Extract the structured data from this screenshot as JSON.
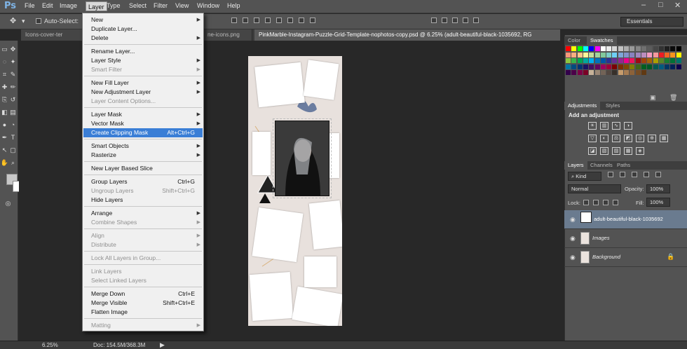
{
  "app": {
    "logo": "Ps"
  },
  "menubar": {
    "items": [
      "File",
      "Edit",
      "Image",
      "Layer",
      "Type",
      "Select",
      "Filter",
      "View",
      "Window",
      "Help"
    ],
    "active": "Layer",
    "window_controls": [
      "–",
      "□",
      "✕"
    ]
  },
  "options": {
    "auto_select_label": "Auto-Select:",
    "workspace": "Essentials"
  },
  "tabs": [
    {
      "label": "Icons-cover-ter"
    },
    {
      "label": "ne-icons.png"
    },
    {
      "label": "PinkMarble-Instagram-Puzzle-Grid-Template-nophotos-copy.psd @ 6.25% (adult-beautiful-black-1035692, RG"
    }
  ],
  "layer_menu": {
    "items": [
      {
        "label": "New",
        "arrow": true
      },
      {
        "label": "Duplicate Layer..."
      },
      {
        "label": "Delete",
        "arrow": true
      },
      {
        "sep": true
      },
      {
        "label": "Rename Layer..."
      },
      {
        "label": "Layer Style",
        "arrow": true
      },
      {
        "label": "Smart Filter",
        "arrow": true,
        "disabled": true
      },
      {
        "sep": true
      },
      {
        "label": "New Fill Layer",
        "arrow": true
      },
      {
        "label": "New Adjustment Layer",
        "arrow": true
      },
      {
        "label": "Layer Content Options...",
        "disabled": true
      },
      {
        "sep": true
      },
      {
        "label": "Layer Mask",
        "arrow": true
      },
      {
        "label": "Vector Mask",
        "arrow": true
      },
      {
        "label": "Create Clipping Mask",
        "shortcut": "Alt+Ctrl+G",
        "highlight": true
      },
      {
        "sep": true
      },
      {
        "label": "Smart Objects",
        "arrow": true
      },
      {
        "label": "Rasterize",
        "arrow": true
      },
      {
        "sep": true
      },
      {
        "label": "New Layer Based Slice"
      },
      {
        "sep": true
      },
      {
        "label": "Group Layers",
        "shortcut": "Ctrl+G"
      },
      {
        "label": "Ungroup Layers",
        "shortcut": "Shift+Ctrl+G",
        "disabled": true
      },
      {
        "label": "Hide Layers"
      },
      {
        "sep": true
      },
      {
        "label": "Arrange",
        "arrow": true
      },
      {
        "label": "Combine Shapes",
        "arrow": true,
        "disabled": true
      },
      {
        "sep": true
      },
      {
        "label": "Align",
        "arrow": true,
        "disabled": true
      },
      {
        "label": "Distribute",
        "arrow": true,
        "disabled": true
      },
      {
        "sep": true
      },
      {
        "label": "Lock All Layers in Group...",
        "disabled": true
      },
      {
        "sep": true
      },
      {
        "label": "Link Layers",
        "disabled": true
      },
      {
        "label": "Select Linked Layers",
        "disabled": true
      },
      {
        "sep": true
      },
      {
        "label": "Merge Down",
        "shortcut": "Ctrl+E"
      },
      {
        "label": "Merge Visible",
        "shortcut": "Shift+Ctrl+E"
      },
      {
        "label": "Flatten Image"
      },
      {
        "sep": true
      },
      {
        "label": "Matting",
        "arrow": true,
        "disabled": true
      }
    ]
  },
  "status": {
    "zoom": "6.25%",
    "doc": "Doc: 154.5M/368.3M"
  },
  "panels": {
    "color_tabs": [
      "Color",
      "Swatches"
    ],
    "adjust_tabs": [
      "Adjustments",
      "Styles"
    ],
    "adjust_title": "Add an adjustment",
    "layer_tabs": [
      "Layers",
      "Channels",
      "Paths"
    ],
    "kind": "Kind",
    "blend_mode": "Normal",
    "opacity_label": "Opacity:",
    "opacity": "100%",
    "lock_label": "Lock:",
    "fill_label": "Fill:",
    "fill": "100%"
  },
  "layers": [
    {
      "name": "adult-beautiful-black-1035692",
      "selected": true
    },
    {
      "name": "Images",
      "selected": false
    },
    {
      "name": "Background",
      "selected": false,
      "locked": true
    }
  ],
  "swatch_colors": [
    "#ff0000",
    "#ffff00",
    "#00ff00",
    "#00ffff",
    "#0000ff",
    "#ff00ff",
    "#ffffff",
    "#ebebeb",
    "#d6d6d6",
    "#c2c2c2",
    "#adadad",
    "#999999",
    "#858585",
    "#707070",
    "#5c5c5c",
    "#474747",
    "#333333",
    "#1f1f1f",
    "#0a0a0a",
    "#000000",
    "#f7977a",
    "#f9ad81",
    "#fdc68a",
    "#fff79a",
    "#c4df9b",
    "#a2d39c",
    "#82ca9d",
    "#7bcdc8",
    "#6ecff6",
    "#7ea7d8",
    "#8493ca",
    "#8882be",
    "#a187be",
    "#bc8dbf",
    "#f49ac2",
    "#f6989d",
    "#ed1c24",
    "#f26522",
    "#f7941d",
    "#fff200",
    "#8dc63f",
    "#39b54a",
    "#00a651",
    "#00a99d",
    "#00aeef",
    "#0072bc",
    "#0054a6",
    "#2e3192",
    "#662d91",
    "#92278f",
    "#ec008c",
    "#ed145b",
    "#9e0b0f",
    "#a0410d",
    "#a3620a",
    "#aba000",
    "#598527",
    "#1a7b30",
    "#007236",
    "#00746b",
    "#0076a3",
    "#004b80",
    "#003471",
    "#1b1464",
    "#440e62",
    "#630460",
    "#9e005d",
    "#9e0039",
    "#790000",
    "#7b2e00",
    "#7d4900",
    "#827b00",
    "#406618",
    "#005e20",
    "#005826",
    "#005952",
    "#005b7f",
    "#003663",
    "#002157",
    "#0d004c",
    "#32004b",
    "#4b0049",
    "#7b0046",
    "#7a0026",
    "#c7b299",
    "#998675",
    "#736357",
    "#534741",
    "#37302a",
    "#c69c6d",
    "#a67c52",
    "#8c6239",
    "#754c24",
    "#603913"
  ],
  "colors": {
    "accent": "#3a7ed6",
    "panel_bg": "#535353",
    "workspace_bg": "#282828",
    "menu_bg": "#f0f0f0"
  }
}
